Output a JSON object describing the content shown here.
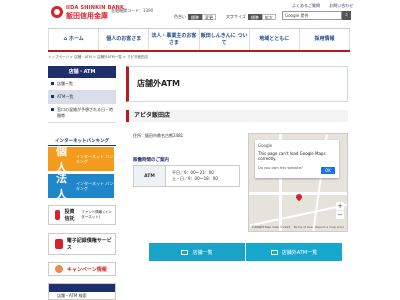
{
  "header": {
    "logo_en": "IIDA SHINKIN BANK",
    "logo_ja": "飯田信用金庫",
    "bank_code": "金融機関コード：1390",
    "top_links": [
      "よくあるご質問",
      "お問い合わせ"
    ],
    "font_size": {
      "label": "文字サイズ",
      "standard": "標準",
      "large": "拡大"
    },
    "color_ctrl": {
      "label": "色合い",
      "standard": "標準",
      "alt": "変更"
    },
    "search_placeholder": "Google 提供",
    "search_icon": "magnifier-icon"
  },
  "nav": [
    {
      "label": "ホーム"
    },
    {
      "label": "個人のお客さま"
    },
    {
      "label": "法人・事業主のお客さま"
    },
    {
      "label": "飯田しんきんに ついて"
    },
    {
      "label": "地域とともに"
    },
    {
      "label": "採用情報"
    }
  ],
  "breadcrumb": "トップページ > 店舗・ATM > 店舗外ATM一覧 > アピタ飯田店",
  "sidebar": {
    "title": "店舗・ATM",
    "items": [
      {
        "label": "店舗一覧",
        "active": false
      },
      {
        "label": "ATM一覧",
        "active": true
      },
      {
        "label": "窓口の混雑が予想される日・時間帯",
        "active": false
      }
    ]
  },
  "internet_banking": {
    "title": "インターネットバンキング",
    "personal": {
      "big": "個人",
      "small": "インターネット バンキング"
    },
    "corporate": {
      "big": "法人",
      "small": "インターネット バンキング"
    }
  },
  "side_links": [
    {
      "label": "投資信託",
      "sub": "ファンド情報 (インターネット)"
    },
    {
      "label": "電子記録債権サービス",
      "sub": ""
    }
  ],
  "campaign": "キャンペーン情報",
  "side2": {
    "label": "店舗・ATM 検索"
  },
  "main": {
    "title": "店舗外ATM",
    "shop_name": "アピタ飯田店",
    "address": "住所：飯田市鼎名古熊2481",
    "hours_heading": "稼働時間のご案内",
    "table": {
      "key": "ATM",
      "lines": [
        "平日／9：00〜21：00",
        "土・日／9：00〜18：00"
      ]
    }
  },
  "map": {
    "card_brand": "Google",
    "card_error": "This page can't load Google Maps correctly.",
    "card_question": "Do you own this website?",
    "ok": "OK",
    "google_label": "Google",
    "footer": "Map data ©2022 · Terms of Use · Report a map error"
  },
  "buttons": [
    {
      "label": "店舗一覧"
    },
    {
      "label": "店舗外ATM一覧"
    }
  ],
  "colors": {
    "brand_red": "#d4232a",
    "navy": "#1f2f6b",
    "orange": "#f29b1c",
    "blue": "#1f86c9",
    "teal": "#19a3c8"
  }
}
